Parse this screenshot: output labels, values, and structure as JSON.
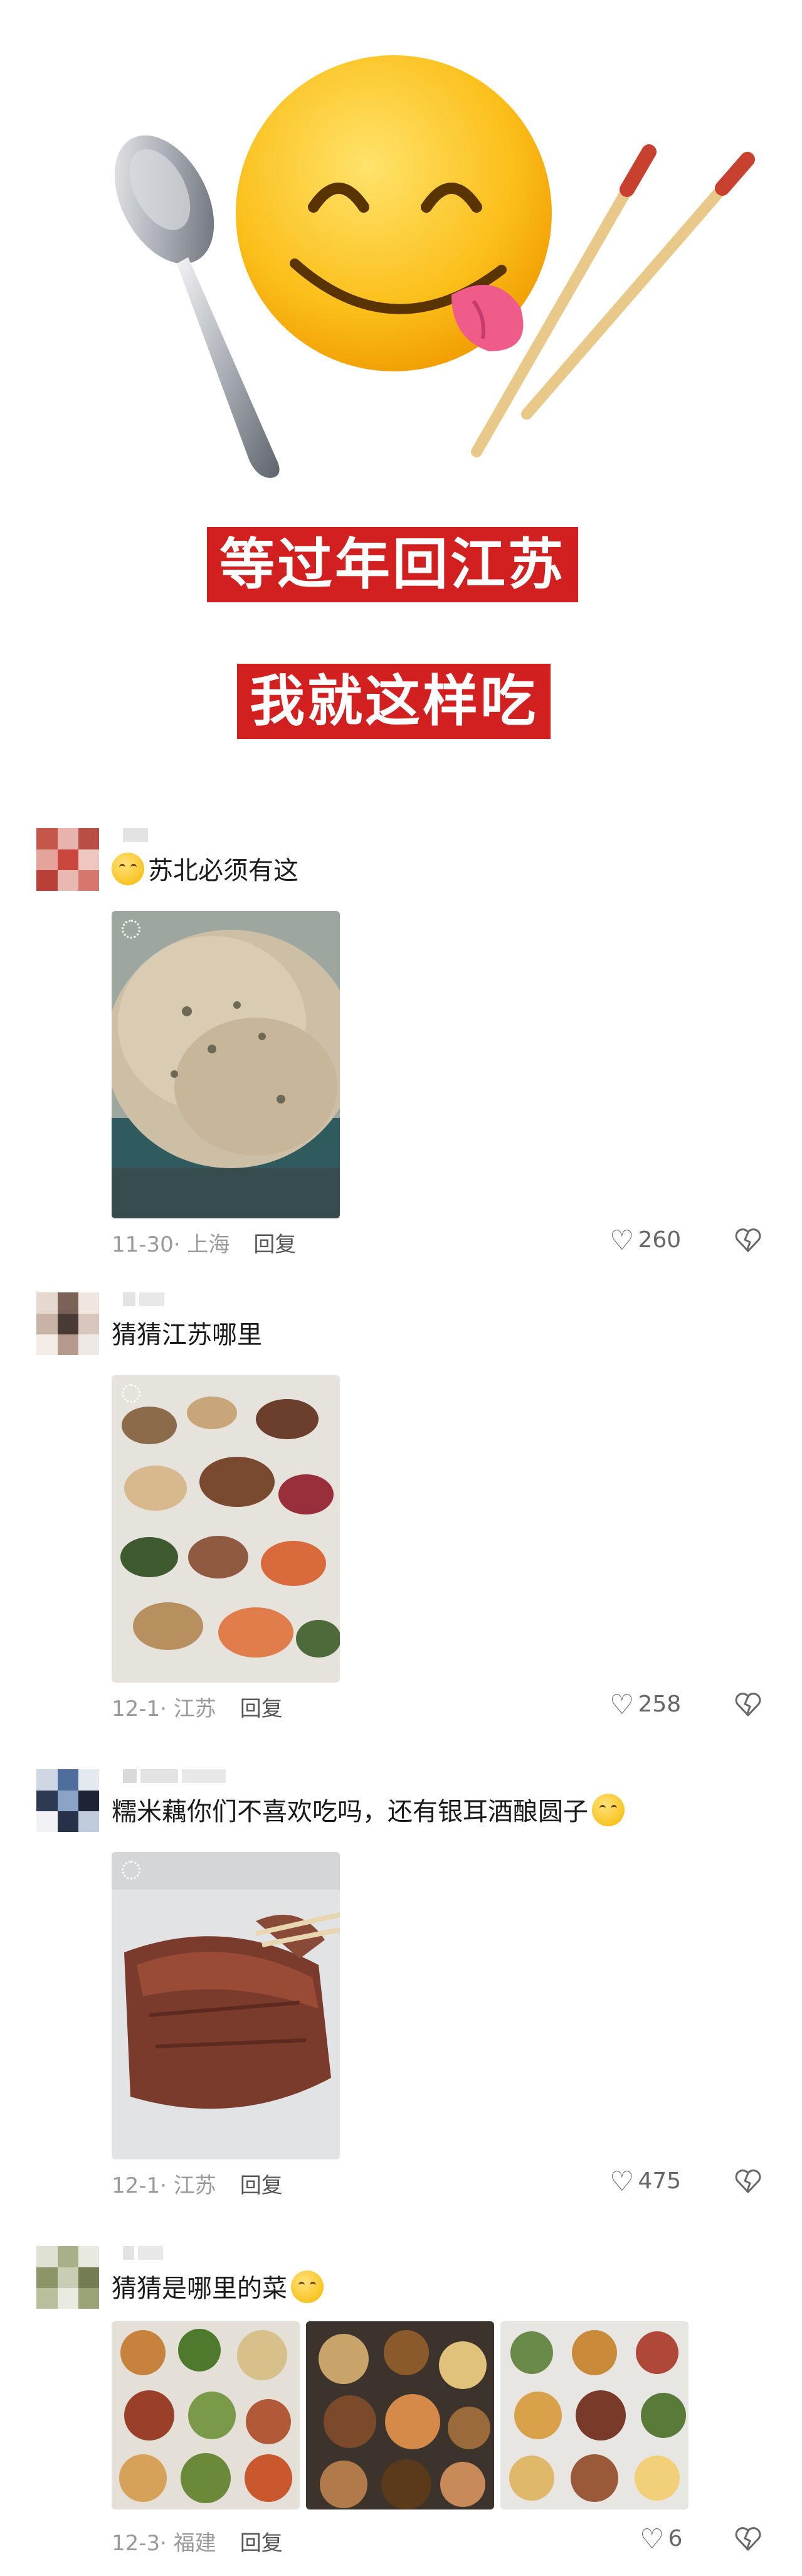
{
  "hero": {
    "title_line1": "等过年回江苏",
    "title_line2": "我就这样吃"
  },
  "comments": [
    {
      "text": "苏北必须有这",
      "emoji_icon": "smirk-emoji-icon",
      "time": "11-30",
      "location": "上海",
      "reply": "回复",
      "likes": "260",
      "image_count": 1
    },
    {
      "text": "猜猜江苏哪里",
      "time": "12-1",
      "location": "江苏",
      "reply": "回复",
      "likes": "258",
      "image_count": 1
    },
    {
      "text": "糯米藕你们不喜欢吃吗，还有银耳酒酿圆子",
      "emoji_icon": "yum-emoji-icon",
      "time": "12-1",
      "location": "江苏",
      "reply": "回复",
      "likes": "475",
      "image_count": 1
    },
    {
      "text": "猜猜是哪里的菜",
      "emoji_icon": "smile-emoji-icon",
      "time": "12-3",
      "location": "福建",
      "reply": "回复",
      "likes": "6",
      "image_count": 3
    }
  ],
  "icons": {
    "like": "heart-outline-icon",
    "dislike": "broken-heart-icon",
    "live": "live-photo-icon"
  },
  "colors": {
    "title_bg": "#d21f1f",
    "meta_text": "#9a9a9a"
  }
}
